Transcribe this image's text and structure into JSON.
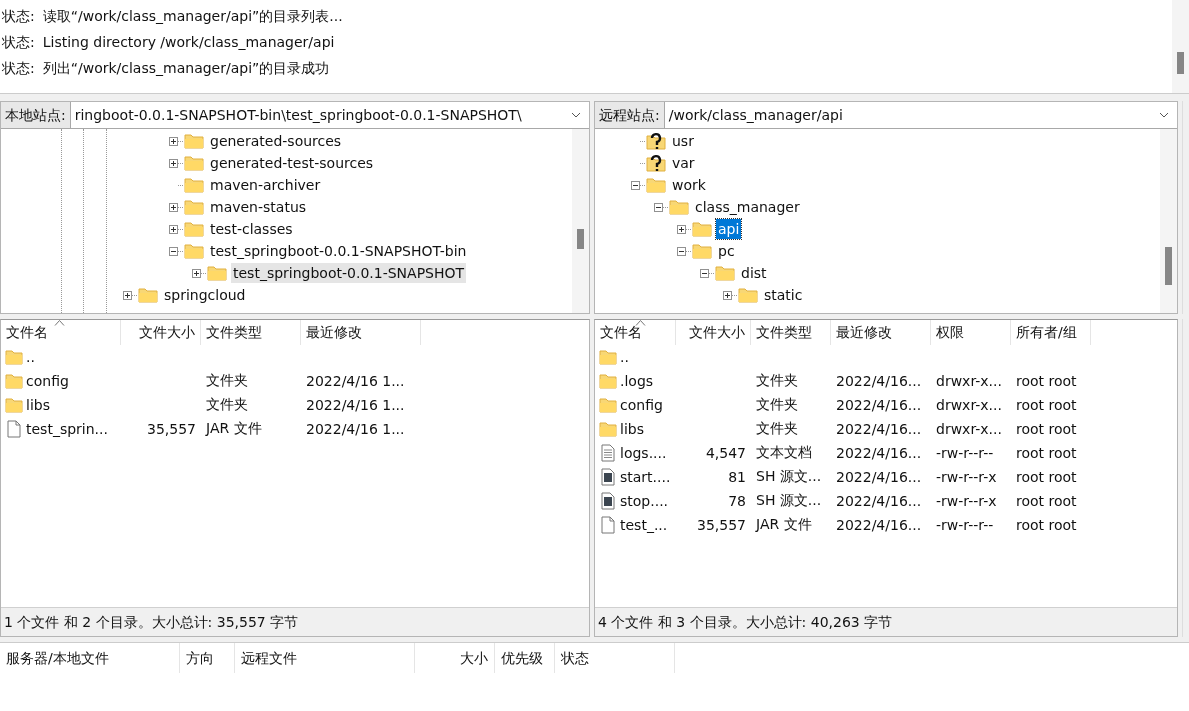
{
  "message_log": [
    {
      "label": "状态:",
      "text": "读取“/work/class_manager/api”的目录列表..."
    },
    {
      "label": "状态:",
      "text": "Listing directory /work/class_manager/api"
    },
    {
      "label": "状态:",
      "text": "列出“/work/class_manager/api”的目录成功"
    }
  ],
  "local_site": {
    "label": "本地站点:",
    "path": "ringboot-0.0.1-SNAPSHOT-bin\\test_springboot-0.0.1-SNAPSHOT\\",
    "tree": [
      {
        "children": [
          {
            "children": [
              {
                "label": "generated-sources",
                "kind": "folder",
                "expanded": false,
                "selected": false
              },
              {
                "label": "generated-test-sources",
                "kind": "folder",
                "expanded": false,
                "selected": false
              },
              {
                "label": "maven-archiver",
                "kind": "leaf",
                "selected": false
              },
              {
                "label": "maven-status",
                "kind": "folder",
                "expanded": false,
                "selected": false
              },
              {
                "label": "test-classes",
                "kind": "folder",
                "expanded": false,
                "selected": false
              },
              {
                "label": "test_springboot-0.0.1-SNAPSHOT-bin",
                "kind": "folder",
                "expanded": true,
                "selected": false,
                "children": [
                  {
                    "label": "test_springboot-0.0.1-SNAPSHOT",
                    "kind": "folder",
                    "expanded": false,
                    "selected": true
                  }
                ]
              }
            ]
          }
        ]
      },
      {
        "label": "springcloud",
        "kind": "folder",
        "expanded": false,
        "selected": false
      }
    ]
  },
  "remote_site": {
    "label": "远程站点:",
    "path": "/work/class_manager/api",
    "tree": [
      {
        "label": "usr",
        "kind": "unknown",
        "selected": false
      },
      {
        "label": "var",
        "kind": "unknown",
        "selected": false
      },
      {
        "label": "work",
        "kind": "folder",
        "expanded": true,
        "selected": false,
        "children": [
          {
            "label": "class_manager",
            "kind": "folder",
            "expanded": true,
            "selected": false,
            "children": [
              {
                "label": "api",
                "kind": "folder",
                "expanded": false,
                "selected": true
              },
              {
                "label": "pc",
                "kind": "folder",
                "expanded": true,
                "selected": false,
                "children": [
                  {
                    "label": "dist",
                    "kind": "folder",
                    "expanded": true,
                    "selected": false,
                    "children": [
                      {
                        "label": "static",
                        "kind": "folder",
                        "expanded": false,
                        "selected": false
                      }
                    ]
                  }
                ]
              }
            ]
          }
        ]
      }
    ]
  },
  "local_files": {
    "columns": [
      "文件名",
      "文件大小",
      "文件类型",
      "最近修改"
    ],
    "rows": [
      {
        "kind": "folder",
        "name": ".."
      },
      {
        "kind": "folder",
        "name": "config",
        "type": "文件夹",
        "modified": "2022/4/16 1..."
      },
      {
        "kind": "folder",
        "name": "libs",
        "type": "文件夹",
        "modified": "2022/4/16 1..."
      },
      {
        "kind": "file",
        "name": "test_sprin...",
        "size": "35,557",
        "type": "JAR 文件",
        "modified": "2022/4/16 1..."
      }
    ],
    "status": "1 个文件 和 2 个目录。大小总计: 35,557 字节"
  },
  "remote_files": {
    "columns": [
      "文件名",
      "文件大小",
      "文件类型",
      "最近修改",
      "权限",
      "所有者/组"
    ],
    "rows": [
      {
        "kind": "folder",
        "name": ".."
      },
      {
        "kind": "folder",
        "name": ".logs",
        "type": "文件夹",
        "modified": "2022/4/16...",
        "permissions": "drwxr-x...",
        "owner": "root root"
      },
      {
        "kind": "folder",
        "name": "config",
        "type": "文件夹",
        "modified": "2022/4/16...",
        "permissions": "drwxr-x...",
        "owner": "root root"
      },
      {
        "kind": "folder",
        "name": "libs",
        "type": "文件夹",
        "modified": "2022/4/16...",
        "permissions": "drwxr-x...",
        "owner": "root root"
      },
      {
        "kind": "text",
        "name": "logs....",
        "size": "4,547",
        "type": "文本文档",
        "modified": "2022/4/16...",
        "permissions": "-rw-r--r--",
        "owner": "root root"
      },
      {
        "kind": "script",
        "name": "start....",
        "size": "81",
        "type": "SH 源文...",
        "modified": "2022/4/16...",
        "permissions": "-rw-r--r-x",
        "owner": "root root"
      },
      {
        "kind": "script",
        "name": "stop....",
        "size": "78",
        "type": "SH 源文...",
        "modified": "2022/4/16...",
        "permissions": "-rw-r--r-x",
        "owner": "root root"
      },
      {
        "kind": "file",
        "name": "test_...",
        "size": "35,557",
        "type": "JAR 文件",
        "modified": "2022/4/16...",
        "permissions": "-rw-r--r--",
        "owner": "root root"
      }
    ],
    "status": "4 个文件 和 3 个目录。大小总计: 40,263 字节"
  },
  "queue": {
    "columns": [
      "服务器/本地文件",
      "方向",
      "远程文件",
      "大小",
      "优先级",
      "状态"
    ]
  }
}
